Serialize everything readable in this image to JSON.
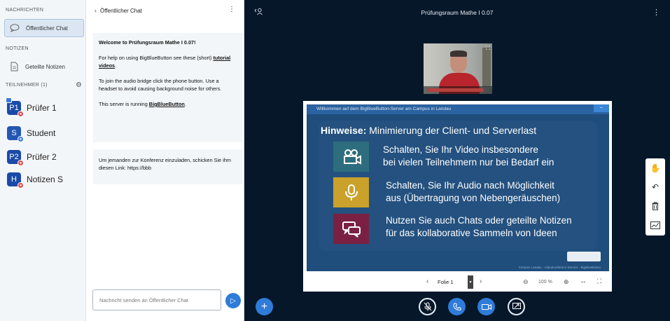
{
  "userlist": {
    "messages_title": "NACHRICHTEN",
    "public_chat_label": "Öffentlicher Chat",
    "notes_title": "NOTIZEN",
    "shared_notes_label": "Geteilte Notizen",
    "participants_title": "TEILNEHMER (1)",
    "users": [
      {
        "initials": "P1",
        "name": "Prüfer 1"
      },
      {
        "initials": "S",
        "name": "Student"
      },
      {
        "initials": "P2",
        "name": "Prüfer 2"
      },
      {
        "initials": "H",
        "name": "Notizen S"
      }
    ]
  },
  "chat": {
    "title": "Öffentlicher Chat",
    "welcome_title": "Welcome to Prüfungsraum Mathe I 0.07!",
    "help_text": "For help on using BigBlueButton see these (short)",
    "help_link": "tutorial videos",
    "help_end": ".",
    "audio_text": "To join the audio bridge click the phone button. Use a headset to avoid causing background noise for others.",
    "server_text": "This server is running",
    "server_link": "BigBlueButton",
    "server_end": ".",
    "invite_text": "Um jemanden zur Konferenz einzuladen, schicken Sie ihm diesen Link: https://bbb",
    "input_placeholder": "Nachricht senden an Öffentlicher Chat"
  },
  "main": {
    "room_title": "Prüfungsraum Mathe I 0.07"
  },
  "slide": {
    "header": "Willkommen auf dem BigBlueButton-Server am Campus in Landau",
    "heading_bold": "Hinweise:",
    "heading_rest": " Minimierung der Client- und Serverlast",
    "items": [
      {
        "line1": "Schalten, Sie Ihr Video insbesondere",
        "line2": "bei vielen Teilnehmern nur bei Bedarf ein",
        "color": "#2e6d7e",
        "icon": "video-camera-icon"
      },
      {
        "line1": "Schalten, Sie Ihr Audio nach Möglichkeit",
        "line2": "aus (Übertragung von Nebengeräuschen)",
        "color": "#c9a12b",
        "icon": "microphone-icon"
      },
      {
        "line1": "Nutzen Sie auch Chats oder geteilte Notizen",
        "line2": "für das  kollaborative Sammeln von Ideen",
        "color": "#7a2143",
        "icon": "chat-bubbles-icon"
      }
    ],
    "footer": "Campus Landau · Videokonferenz-Service · BigBlueButton"
  },
  "presentation": {
    "slide_label": "Folie 1",
    "zoom": "100 %"
  },
  "colors": {
    "accent": "#2f7bd8",
    "main_bg": "#06172a",
    "slide_bg": "#1f4d7c"
  }
}
